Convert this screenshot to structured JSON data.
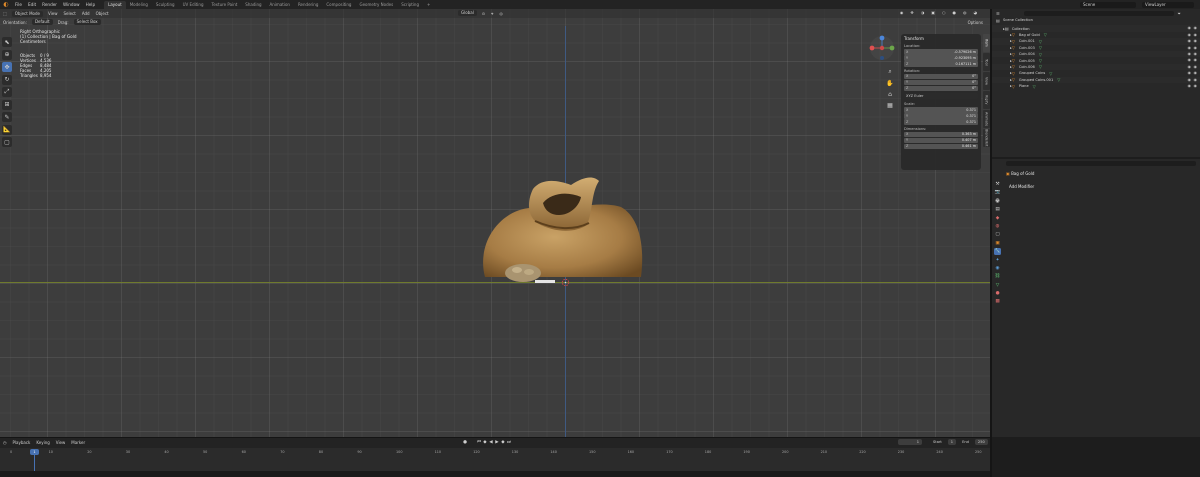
{
  "menu": {
    "items": [
      "File",
      "Edit",
      "Render",
      "Window",
      "Help"
    ],
    "workspaces": [
      "Layout",
      "Modeling",
      "Sculpting",
      "UV Editing",
      "Texture Paint",
      "Shading",
      "Animation",
      "Rendering",
      "Compositing",
      "Geometry Nodes",
      "Scripting"
    ],
    "active_workspace": "Layout",
    "scene": "Scene",
    "view_layer": "ViewLayer"
  },
  "viewport": {
    "mode": "Object Mode",
    "menus": [
      "View",
      "Select",
      "Add",
      "Object"
    ],
    "orientation_label": "Orientation:",
    "orientation_value": "Default",
    "drag_label": "Drag:",
    "drag_value": "Select Box",
    "transform_space": "Global",
    "options_label": "Options",
    "view_name": "Right Orthographic",
    "collection_info": "(1) Collection | Bag of Gold",
    "units": "Centimeters",
    "stats": [
      {
        "label": "Objects",
        "value": "0 / 9"
      },
      {
        "label": "Vertices",
        "value": "4,536"
      },
      {
        "label": "Edges",
        "value": "8,484"
      },
      {
        "label": "Faces",
        "value": "4,205"
      },
      {
        "label": "Triangles",
        "value": "8,954"
      }
    ]
  },
  "npanel": {
    "title": "Transform",
    "location_label": "Location:",
    "location": [
      {
        "axis": "X",
        "value": "-0.579026 m"
      },
      {
        "axis": "Y",
        "value": "-0.923095 m"
      },
      {
        "axis": "Z",
        "value": "0.167111 m"
      }
    ],
    "rotation_label": "Rotation:",
    "rotation": [
      {
        "axis": "X",
        "value": "0°"
      },
      {
        "axis": "Y",
        "value": "0°"
      },
      {
        "axis": "Z",
        "value": "0°"
      }
    ],
    "rotation_mode": "XYZ Euler",
    "scale_label": "Scale:",
    "scale": [
      {
        "axis": "X",
        "value": "0.371"
      },
      {
        "axis": "Y",
        "value": "0.371"
      },
      {
        "axis": "Z",
        "value": "0.371"
      }
    ],
    "dimensions_label": "Dimensions:",
    "dimensions": [
      {
        "axis": "X",
        "value": "0.363 m"
      },
      {
        "axis": "Y",
        "value": "0.407 m"
      },
      {
        "axis": "Z",
        "value": "0.461 m"
      }
    ],
    "tabs": [
      "Item",
      "Tool",
      "View",
      "Rigify",
      "Animate",
      "Blenderkit"
    ]
  },
  "outliner": {
    "scene_collection": "Scene Collection",
    "rows": [
      {
        "name": "Collection",
        "indent": 1,
        "icon": "collection-icon"
      },
      {
        "name": "Bag of Gold",
        "indent": 2,
        "icon": "mesh-icon"
      },
      {
        "name": "Coin.001",
        "indent": 2,
        "icon": "mesh-icon"
      },
      {
        "name": "Coin.003",
        "indent": 2,
        "icon": "mesh-icon"
      },
      {
        "name": "Coin.004",
        "indent": 2,
        "icon": "mesh-icon"
      },
      {
        "name": "Coin.005",
        "indent": 2,
        "icon": "mesh-icon"
      },
      {
        "name": "Coin.006",
        "indent": 2,
        "icon": "mesh-icon"
      },
      {
        "name": "Grouped Coins",
        "indent": 2,
        "icon": "mesh-icon"
      },
      {
        "name": "Grouped Coins.001",
        "indent": 2,
        "icon": "mesh-icon"
      },
      {
        "name": "Plane",
        "indent": 2,
        "icon": "mesh-icon"
      }
    ]
  },
  "properties": {
    "object_name": "Bag of Gold",
    "add_modifier": "Add Modifier"
  },
  "timeline": {
    "menus": [
      "Playback",
      "Keying",
      "View",
      "Marker"
    ],
    "current_frame": "1",
    "start_label": "Start",
    "start_value": "1",
    "end_label": "End",
    "end_value": "250",
    "frame_labels": [
      "0",
      "10",
      "20",
      "30",
      "40",
      "50",
      "60",
      "70",
      "80",
      "90",
      "100",
      "110",
      "120",
      "130",
      "140",
      "150",
      "160",
      "170",
      "180",
      "190",
      "200",
      "210",
      "220",
      "230",
      "240",
      "250"
    ]
  },
  "colors": {
    "accent": "#4772b3",
    "selection": "#e08a2a",
    "axis_x": "#6f7a2e",
    "axis_z": "#3f5a82"
  }
}
